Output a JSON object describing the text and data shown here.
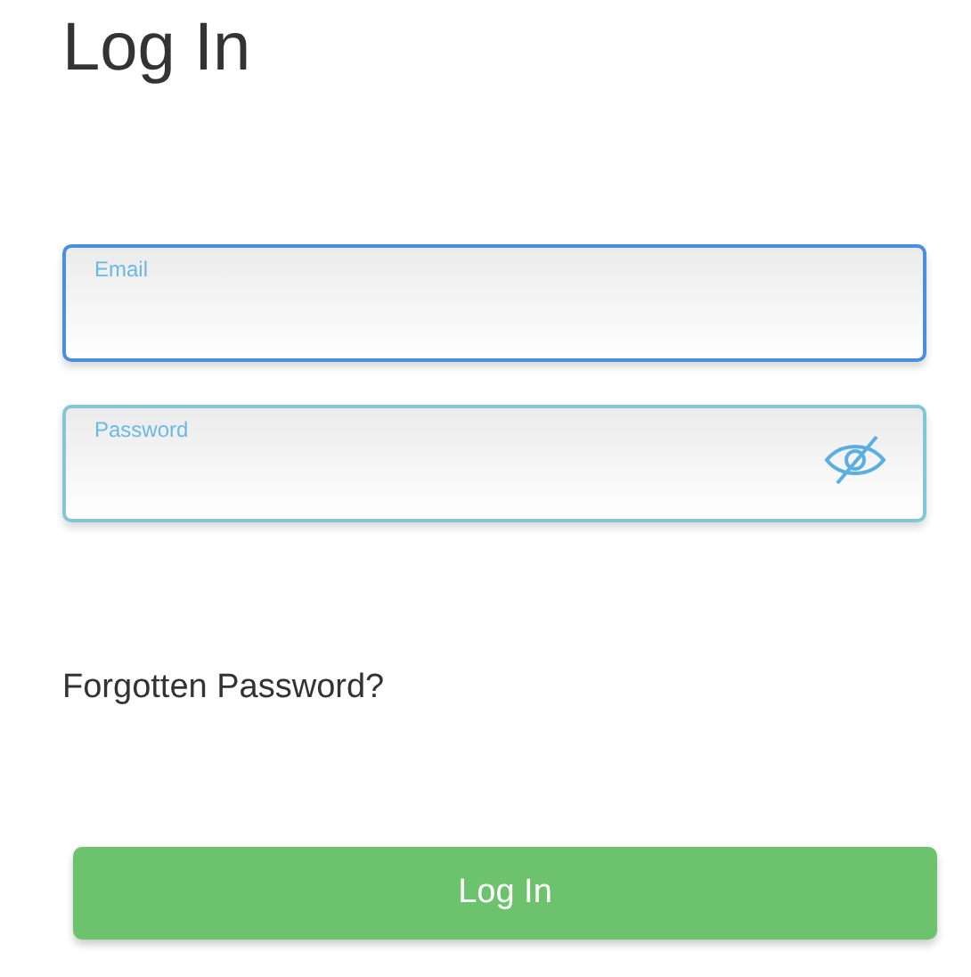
{
  "title": "Log In",
  "fields": [
    {
      "kind": "text",
      "placeholder": "Email",
      "focused": true
    },
    {
      "kind": "password",
      "placeholder": "Password",
      "focused": false
    }
  ],
  "forgot_link": "Forgotten Password?",
  "submit_button": "Log In"
}
